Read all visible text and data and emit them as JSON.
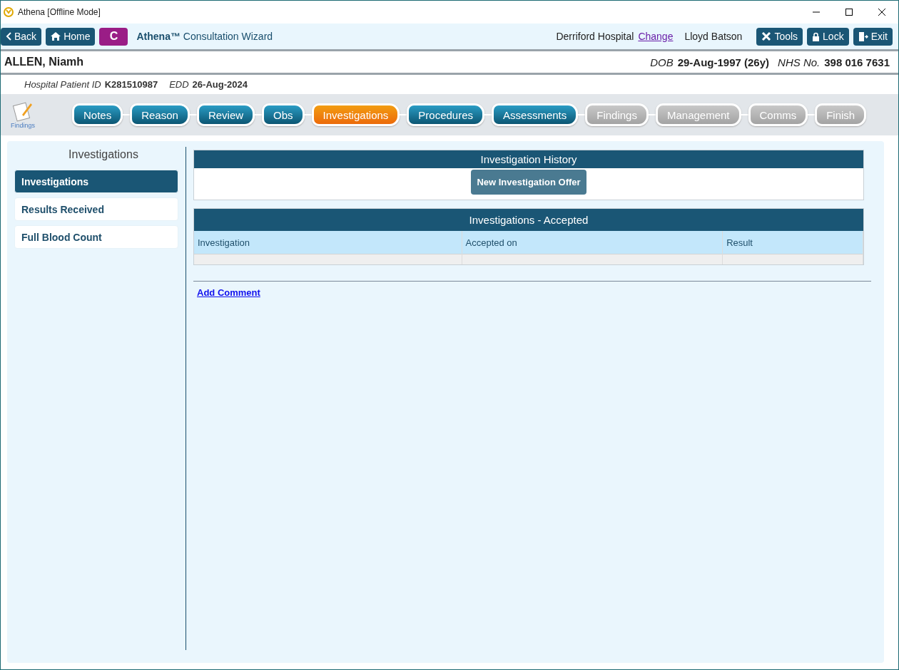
{
  "window": {
    "title": "Athena [Offline Mode]"
  },
  "nav": {
    "back": "Back",
    "home": "Home",
    "badge": "C",
    "app_title": "**Athena™** Consultation Wizard",
    "location": "Derriford Hospital",
    "change_link": "Change",
    "user": "Lloyd Batson",
    "tools": "Tools",
    "lock": "Lock",
    "exit": "Exit"
  },
  "patient": {
    "name": "ALLEN, Niamh",
    "dob_label": "DOB",
    "dob": "29-Aug-1997 (26y)",
    "nhs_label": "NHS No.",
    "nhs": "398 016 7631",
    "hospital_id_label": "Hospital Patient ID",
    "hospital_id": "K281510987",
    "edd_label": "EDD",
    "edd": "26-Aug-2024"
  },
  "findings_shortcut": {
    "label": "Findings"
  },
  "steps": [
    {
      "label": "Notes",
      "selected": false,
      "disabled": false
    },
    {
      "label": "Reason",
      "selected": false,
      "disabled": false
    },
    {
      "label": "Review",
      "selected": false,
      "disabled": false
    },
    {
      "label": "Obs",
      "selected": false,
      "disabled": false
    },
    {
      "label": "Investigations",
      "selected": true,
      "disabled": false
    },
    {
      "label": "Procedures",
      "selected": false,
      "disabled": false
    },
    {
      "label": "Assessments",
      "selected": false,
      "disabled": false
    },
    {
      "label": "Findings",
      "selected": false,
      "disabled": true
    },
    {
      "label": "Management",
      "selected": false,
      "disabled": true
    },
    {
      "label": "Comms",
      "selected": false,
      "disabled": true
    },
    {
      "label": "Finish",
      "selected": false,
      "disabled": true
    }
  ],
  "sidebar": {
    "title": "Investigations",
    "items": [
      {
        "label": "Investigations",
        "selected": true
      },
      {
        "label": "Results Received",
        "selected": false
      },
      {
        "label": "Full Blood Count",
        "selected": false
      }
    ]
  },
  "history": {
    "title": "Investigation History",
    "button": "New Investigation Offer"
  },
  "accepted": {
    "title": "Investigations - Accepted",
    "columns": [
      "Investigation",
      "Accepted on",
      "Result"
    ]
  },
  "add_comment": "Add Comment"
}
